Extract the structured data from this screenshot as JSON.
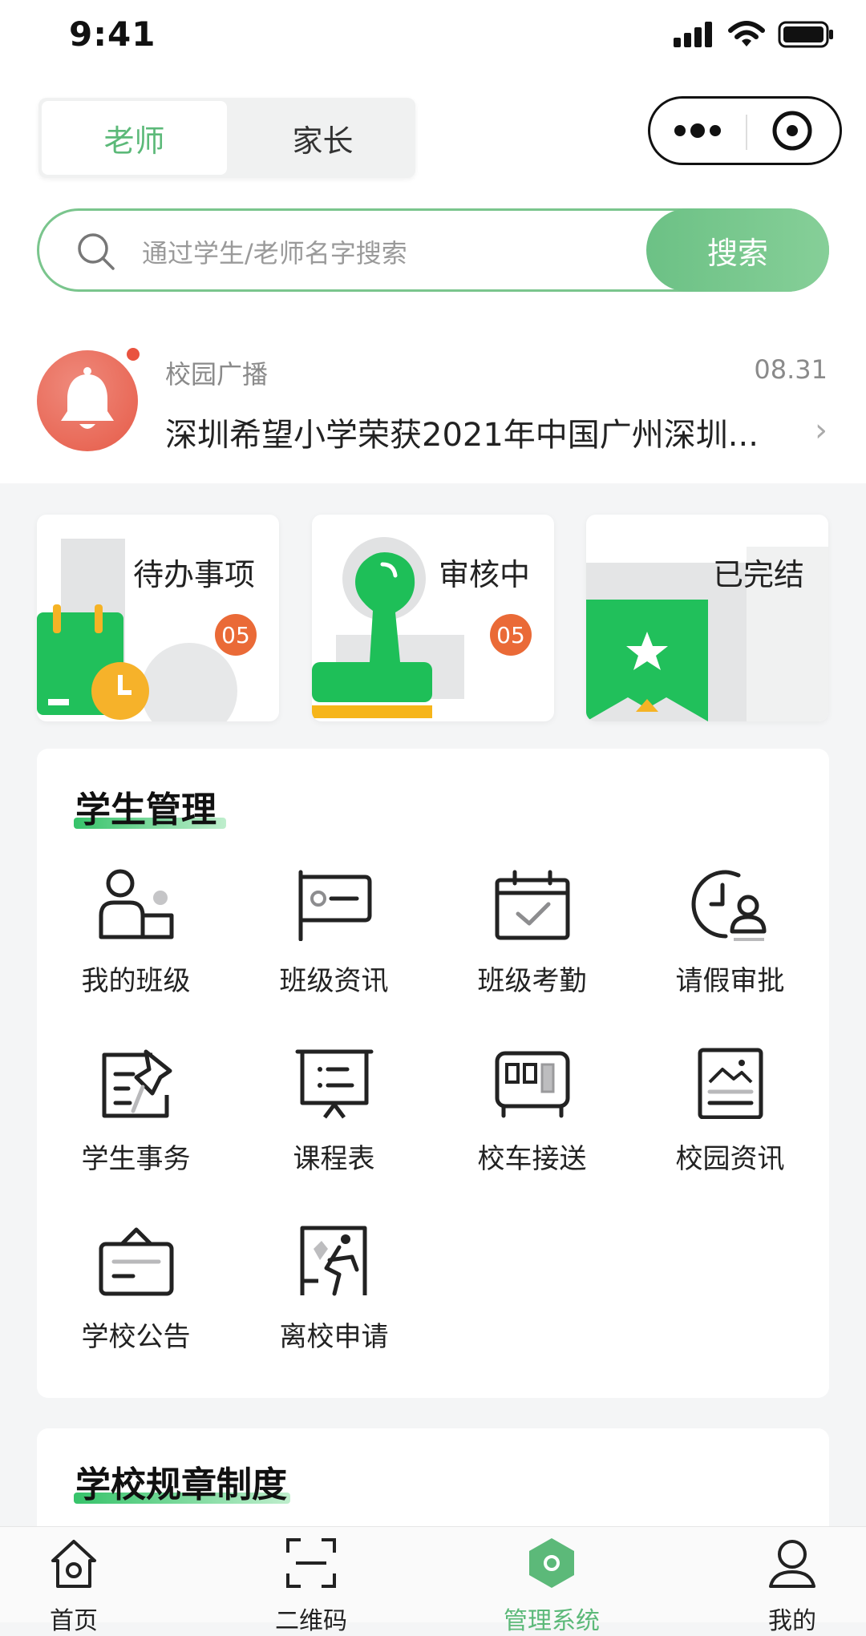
{
  "status_bar": {
    "time": "9:41"
  },
  "role_tabs": [
    {
      "label": "老师",
      "active": true
    },
    {
      "label": "家长",
      "active": false
    }
  ],
  "capsule": {
    "more_icon": "ellipsis-icon",
    "close_icon": "target-icon"
  },
  "search": {
    "placeholder": "通过学生/老师名字搜索",
    "button_label": "搜索"
  },
  "notice": {
    "category": "校园广播",
    "date": "08.31",
    "text": "深圳希望小学荣获2021年中国广州深圳..."
  },
  "status_cards": [
    {
      "title": "待办事项",
      "badge": "05",
      "icon": "calendar-clock-icon"
    },
    {
      "title": "审核中",
      "badge": "05",
      "icon": "stamp-icon"
    },
    {
      "title": "已完结",
      "icon": "bookmark-star-icon"
    }
  ],
  "student_management": {
    "title": "学生管理",
    "items": [
      {
        "label": "我的班级",
        "icon": "class-people-icon"
      },
      {
        "label": "班级资讯",
        "icon": "class-news-flag-icon"
      },
      {
        "label": "班级考勤",
        "icon": "calendar-check-icon"
      },
      {
        "label": "请假审批",
        "icon": "clock-person-icon"
      },
      {
        "label": "学生事务",
        "icon": "pin-edit-icon"
      },
      {
        "label": "课程表",
        "icon": "easel-list-icon"
      },
      {
        "label": "校车接送",
        "icon": "bus-icon"
      },
      {
        "label": "校园资讯",
        "icon": "picture-doc-icon"
      },
      {
        "label": "学校公告",
        "icon": "notice-board-icon"
      },
      {
        "label": "离校申请",
        "icon": "exit-door-icon"
      }
    ]
  },
  "rules_section": {
    "title": "学校规章制度"
  },
  "tab_bar": [
    {
      "label": "首页",
      "icon": "home-icon",
      "active": false
    },
    {
      "label": "二维码",
      "icon": "scan-icon",
      "active": false
    },
    {
      "label": "管理系统",
      "icon": "hexagon-icon",
      "active": true
    },
    {
      "label": "我的",
      "icon": "profile-icon",
      "active": false
    }
  ],
  "colors": {
    "accent": "#5cb979",
    "badge": "#ea6a37",
    "card_green": "#1fbf5a",
    "bell_red": "#e65b48"
  }
}
